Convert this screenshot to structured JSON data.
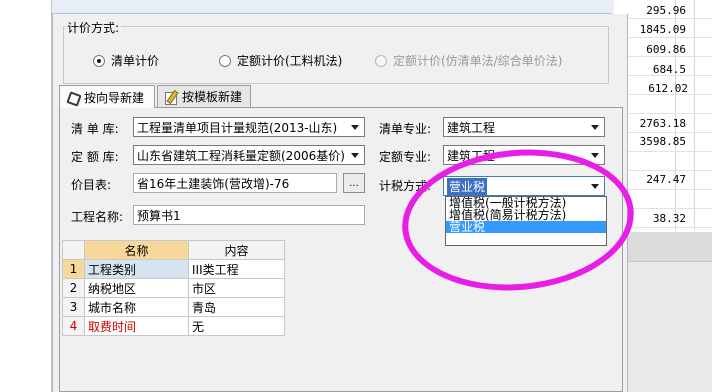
{
  "background": {
    "numbers": [
      "295.96",
      "1845.09",
      "609.86",
      "684.5",
      "612.02",
      "2763.18",
      "3598.85",
      "247.47",
      "38.32"
    ]
  },
  "dialog": {
    "pricing_group": {
      "title": "计价方式:",
      "options": [
        {
          "label": "清单计价",
          "selected": true,
          "disabled": false
        },
        {
          "label": "定额计价(工料机法)",
          "selected": false,
          "disabled": false
        },
        {
          "label": "定额计价(仿清单法/综合单价法)",
          "selected": false,
          "disabled": true
        }
      ]
    },
    "tabs": [
      {
        "label": "按向导新建",
        "icon": "wizard-icon",
        "active": true
      },
      {
        "label": "按模板新建",
        "icon": "template-icon",
        "active": false
      }
    ],
    "form": {
      "list_lib_label": "清 单 库:",
      "list_lib_value": "工程量清单项目计量规范(2013-山东)",
      "list_major_label": "清单专业:",
      "list_major_value": "建筑工程",
      "quota_lib_label": "定 额 库:",
      "quota_lib_value": "山东省建筑工程消耗量定额(2006基价)",
      "quota_major_label": "定额专业:",
      "quota_major_value": "建筑工程",
      "price_table_label": "价目表:",
      "price_table_value": "省16年土建装饰(营改增)-76",
      "browse_label": "...",
      "tax_method_label": "计税方式:",
      "tax_method_value": "营业税",
      "project_name_label": "工程名称:",
      "project_name_value": "预算书1"
    },
    "tax_dropdown": {
      "options": [
        "增值税(一般计税方法)",
        "增值税(简易计税方法)",
        "营业税"
      ],
      "highlighted": "营业税"
    },
    "grid": {
      "headers": [
        "名称",
        "内容"
      ],
      "rows": [
        {
          "idx": "1",
          "name": "工程类别",
          "value": "III类工程"
        },
        {
          "idx": "2",
          "name": "纳税地区",
          "value": "市区"
        },
        {
          "idx": "3",
          "name": "城市名称",
          "value": "青岛"
        },
        {
          "idx": "4",
          "name": "取费时间",
          "value": "无",
          "name_color": "#d40000"
        }
      ]
    }
  },
  "colors": {
    "annotation": "#e81ee6",
    "selection": "#3399ff",
    "header_highlight": "#f7d79a"
  }
}
